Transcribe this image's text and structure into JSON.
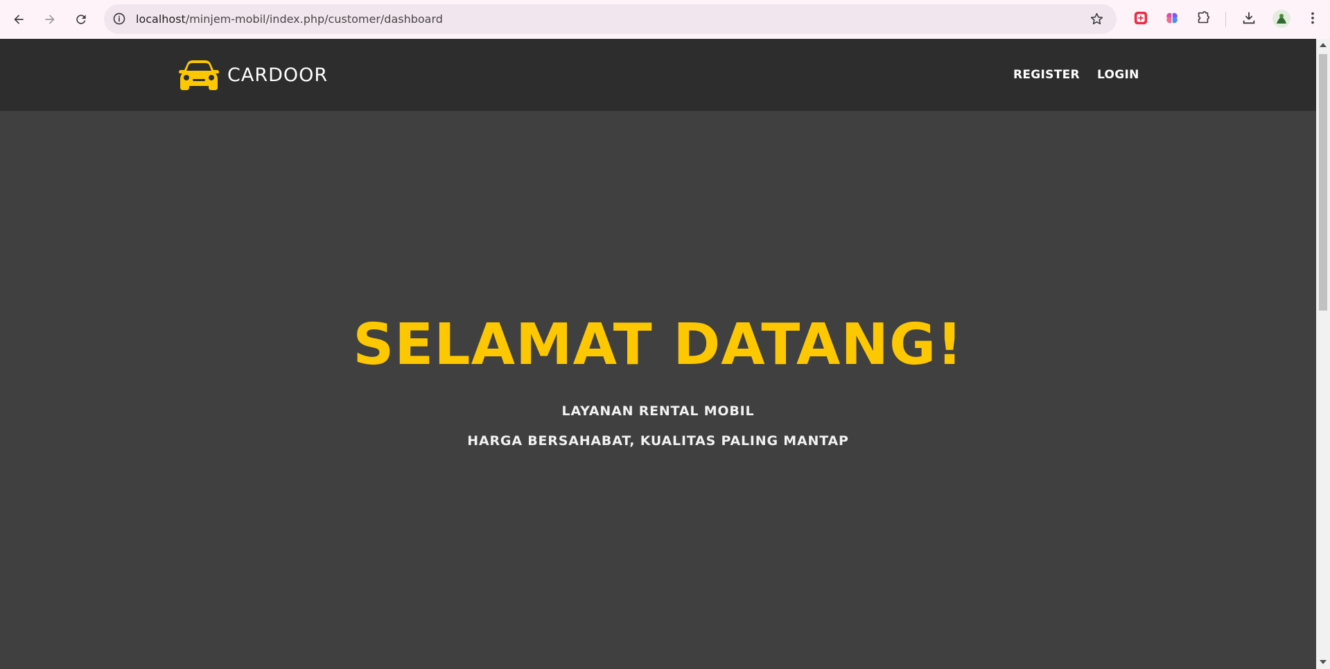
{
  "browser": {
    "url_host": "localhost",
    "url_path": "/minjem-mobil/index.php/customer/dashboard",
    "icons": [
      "back-icon",
      "forward-icon",
      "reload-icon",
      "site-info-icon",
      "bookmark-star-icon",
      "extension-red-icon",
      "extension-brain-icon",
      "extensions-puzzle-icon",
      "download-icon",
      "profile-avatar",
      "more-menu-icon"
    ]
  },
  "header": {
    "brand": "CARDOOR",
    "nav": [
      {
        "label": "REGISTER"
      },
      {
        "label": "LOGIN"
      }
    ]
  },
  "hero": {
    "title": "SELAMAT DATANG!",
    "subtitle_1": "LAYANAN RENTAL MOBIL",
    "subtitle_2": "HARGA BERSAHABAT, KUALITAS PALING MANTAP"
  },
  "colors": {
    "accent": "#fdc800",
    "header_bg": "#2d2d2d",
    "hero_bg": "#404040"
  }
}
